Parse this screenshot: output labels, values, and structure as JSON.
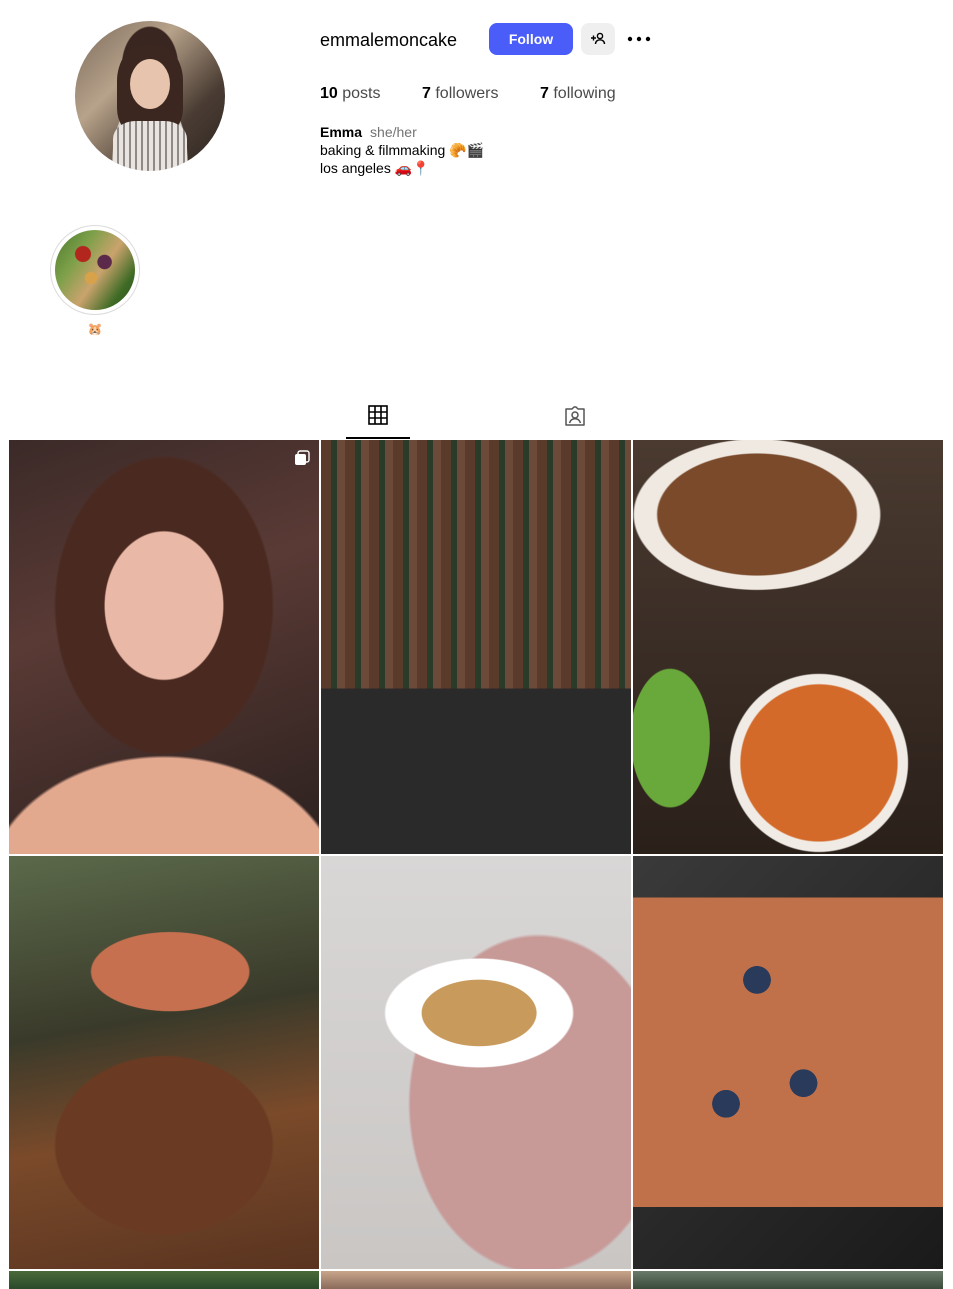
{
  "profile": {
    "username": "emmalemoncake",
    "follow_label": "Follow",
    "stats": {
      "posts_count": "10",
      "posts_label": "posts",
      "followers_count": "7",
      "followers_label": "followers",
      "following_count": "7",
      "following_label": "following"
    },
    "bio": {
      "name": "Emma",
      "pronouns": "she/her",
      "line1": "baking & filmmaking 🥐🎬",
      "line2": "los angeles 🚗📍"
    }
  },
  "highlights": [
    {
      "label": "🐹"
    }
  ],
  "tabs": [
    {
      "icon": "grid-icon",
      "active": true
    },
    {
      "icon": "tagged-icon",
      "active": false
    }
  ],
  "posts": [
    {
      "subject": "portrait",
      "multi": true
    },
    {
      "subject": "wine-glasses-bar",
      "multi": false
    },
    {
      "subject": "noodle-soup",
      "multi": false
    },
    {
      "subject": "cocktail",
      "multi": false
    },
    {
      "subject": "pancakes",
      "multi": false
    },
    {
      "subject": "blueberry-cake",
      "multi": false
    },
    {
      "subject": "partial",
      "multi": false
    },
    {
      "subject": "partial",
      "multi": false
    },
    {
      "subject": "partial",
      "multi": false
    }
  ],
  "colors": {
    "accent": "#4a5df9",
    "secondary_button": "#efefef",
    "muted_text": "#737373"
  }
}
